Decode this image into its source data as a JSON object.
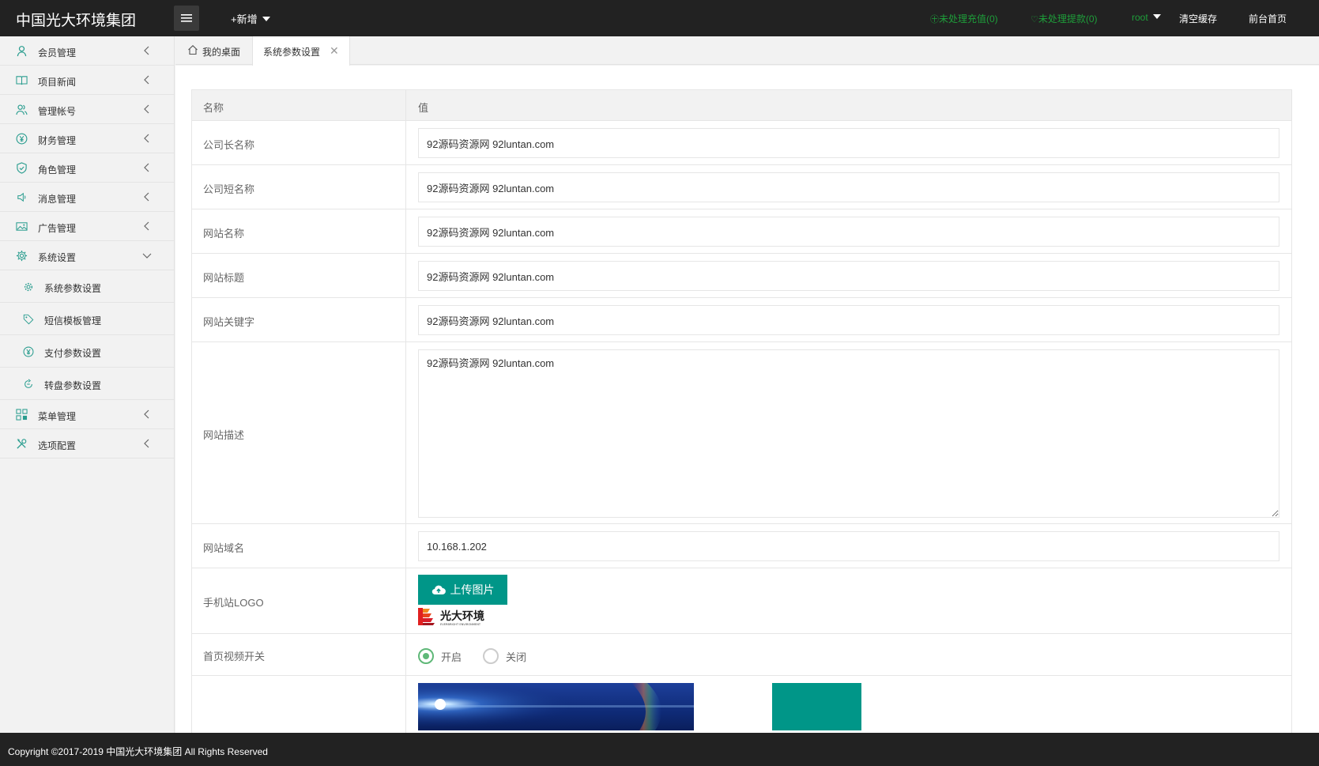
{
  "header": {
    "logo_text": "中国光大环境集团",
    "add_new": "+新增",
    "pending_recharge": "未处理充值(0)",
    "pending_withdraw": "未处理提款(0)",
    "user": "root",
    "clear_cache": "清空缓存",
    "front_home": "前台首页",
    "colors": {
      "bar": "#222222",
      "alert": "#1e9e3a"
    }
  },
  "sidebar": {
    "items": [
      {
        "label": "会员管理",
        "icon": "user-icon"
      },
      {
        "label": "项目新闻",
        "icon": "book-icon"
      },
      {
        "label": "管理帐号",
        "icon": "users-icon"
      },
      {
        "label": "财务管理",
        "icon": "yen-icon"
      },
      {
        "label": "角色管理",
        "icon": "shield-icon"
      },
      {
        "label": "消息管理",
        "icon": "speaker-icon"
      },
      {
        "label": "广告管理",
        "icon": "image-icon"
      },
      {
        "label": "系统设置",
        "icon": "gear-icon",
        "expanded": true
      }
    ],
    "subitems": [
      {
        "label": "系统参数设置",
        "icon": "gear-icon"
      },
      {
        "label": "短信模板管理",
        "icon": "tag-icon"
      },
      {
        "label": "支付参数设置",
        "icon": "yen-icon"
      },
      {
        "label": "转盘参数设置",
        "icon": "cycle-icon"
      }
    ],
    "items_after": [
      {
        "label": "菜单管理",
        "icon": "grid-icon"
      },
      {
        "label": "选项配置",
        "icon": "tools-icon"
      }
    ]
  },
  "tabs": [
    {
      "label": "我的桌面",
      "icon": "home-icon"
    },
    {
      "label": "系统参数设置",
      "active": true
    }
  ],
  "table": {
    "header": {
      "name": "名称",
      "value": "值"
    },
    "rows": {
      "company_full": {
        "label": "公司长名称",
        "value": "92源码资源网 92luntan.com"
      },
      "company_short": {
        "label": "公司短名称",
        "value": "92源码资源网 92luntan.com"
      },
      "site_name": {
        "label": "网站名称",
        "value": "92源码资源网 92luntan.com"
      },
      "site_title": {
        "label": "网站标题",
        "value": "92源码资源网 92luntan.com"
      },
      "site_keywords": {
        "label": "网站关键字",
        "value": "92源码资源网 92luntan.com"
      },
      "site_description": {
        "label": "网站描述",
        "value": "92源码资源网 92luntan.com"
      },
      "site_domain": {
        "label": "网站域名",
        "value": "10.168.1.202"
      },
      "mobile_logo": {
        "label": "手机站LOGO",
        "button": "上传图片",
        "logo_text": "光大环境",
        "logo_subtext": "EVERBRIGHT ENVIRONMENT"
      },
      "video_switch": {
        "label": "首页视频开关",
        "on": "开启",
        "off": "关闭",
        "selected": "on"
      }
    }
  },
  "footer": {
    "copyright": "Copyright ©2017-2019 中国光大环境集团 All Rights Reserved"
  },
  "colors": {
    "accent": "#009688",
    "radio": "#5fb878"
  }
}
